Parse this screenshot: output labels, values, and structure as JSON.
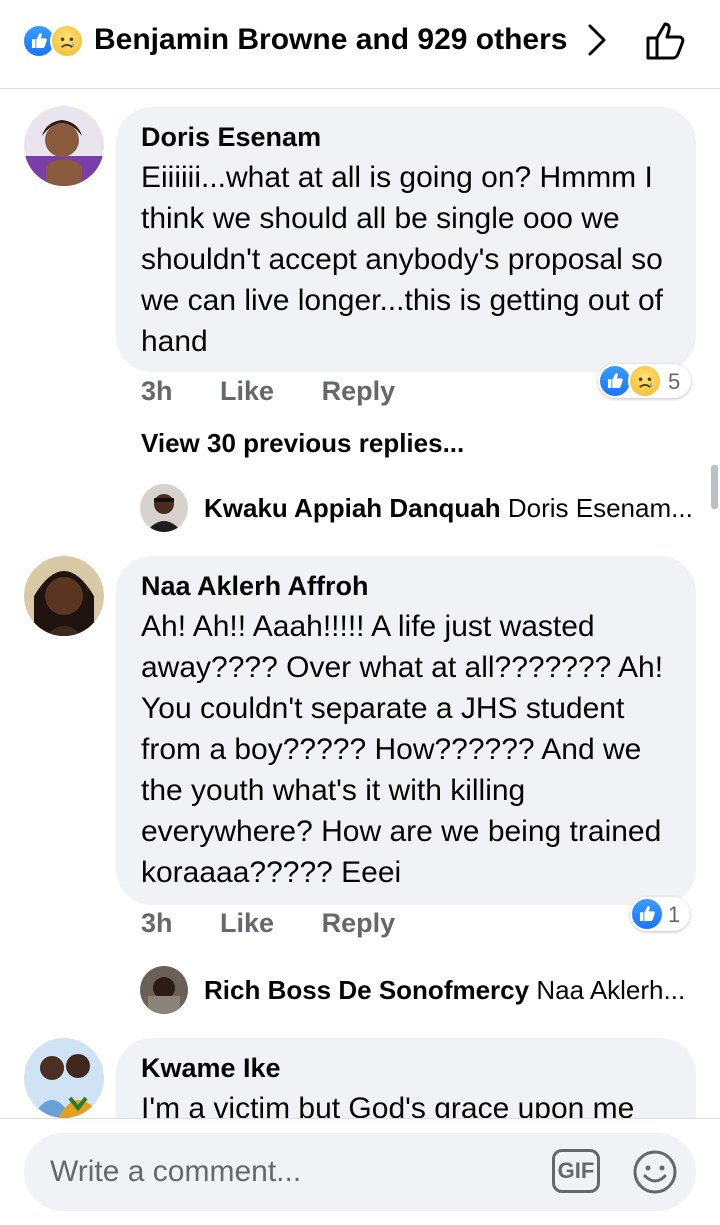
{
  "header": {
    "reactions_summary": "Benjamin Browne and 929 others",
    "reaction_icons": [
      "like-icon",
      "sad-icon"
    ],
    "chevron_icon": "chevron-right-icon",
    "like_icon": "thumbs-up-outline-icon"
  },
  "comments": [
    {
      "author": "Doris Esenam",
      "text": "Eiiiiii...what at all is going on? Hmmm I think we should all be single ooo we shouldn't accept anybody's proposal so we can live longer...this is getting out of hand",
      "time": "3h",
      "like_label": "Like",
      "reply_label": "Reply",
      "reaction_icons": [
        "like-icon",
        "sad-icon"
      ],
      "reaction_count": "5",
      "view_previous": "View 30 previous replies...",
      "latest_reply": {
        "author": "Kwaku Appiah Danquah",
        "snippet": "Doris Esenam..."
      }
    },
    {
      "author": "Naa Aklerh Affroh",
      "text": "Ah! Ah!! Aaah!!!!! A life just wasted away???? Over what at all??????? Ah! You couldn't separate a JHS student from a boy????? How?????? And we the youth what's it with killing everywhere? How are we being trained koraaaa????? Eeei",
      "time": "3h",
      "like_label": "Like",
      "reply_label": "Reply",
      "reaction_icons": [
        "like-icon"
      ],
      "reaction_count": "1",
      "latest_reply": {
        "author": "Rich Boss De Sonofmercy",
        "snippet": "Naa Aklerh..."
      }
    },
    {
      "author": "Kwame Ike",
      "text": "I'm a victim but God's grace upon me"
    }
  ],
  "composer": {
    "placeholder": "Write a comment...",
    "gif_label": "GIF",
    "emoji_icon": "smiley-icon"
  },
  "colors": {
    "like_blue": "#1877f2",
    "bubble_bg": "#f0f2f5",
    "meta_gray": "#65676b"
  }
}
